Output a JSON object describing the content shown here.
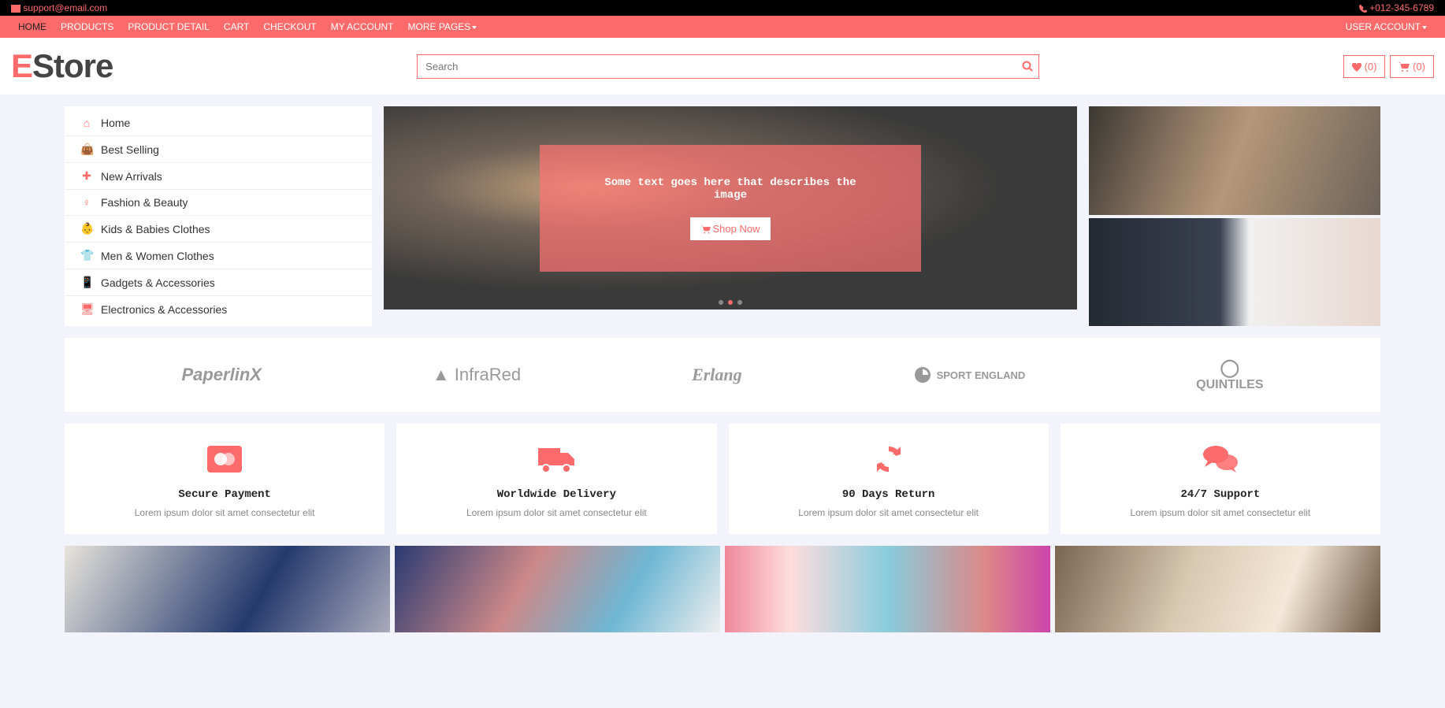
{
  "top": {
    "email": "support@email.com",
    "phone": "+012-345-6789"
  },
  "nav": {
    "items": [
      "HOME",
      "PRODUCTS",
      "PRODUCT DETAIL",
      "CART",
      "CHECKOUT",
      "MY ACCOUNT",
      "MORE PAGES"
    ],
    "user": "USER ACCOUNT"
  },
  "logo": {
    "e": "E",
    "rest": "Store"
  },
  "search": {
    "placeholder": "Search"
  },
  "headerBtns": {
    "wish": "(0)",
    "cart": "(0)"
  },
  "sidebar": [
    {
      "icon": "home",
      "label": "Home"
    },
    {
      "icon": "bag",
      "label": "Best Selling"
    },
    {
      "icon": "plus",
      "label": "New Arrivals"
    },
    {
      "icon": "female",
      "label": "Fashion & Beauty"
    },
    {
      "icon": "child",
      "label": "Kids & Babies Clothes"
    },
    {
      "icon": "shirt",
      "label": "Men & Women Clothes"
    },
    {
      "icon": "mobile",
      "label": "Gadgets & Accessories"
    },
    {
      "icon": "tv",
      "label": "Electronics & Accessories"
    }
  ],
  "hero": {
    "text": "Some text goes here that describes the image",
    "btn": "Shop Now"
  },
  "brands": [
    "PaperlinX",
    "InfraRed",
    "Erlang",
    "SPORT ENGLAND",
    "QUINTILES"
  ],
  "features": [
    {
      "title": "Secure Payment",
      "desc": "Lorem ipsum dolor sit amet consectetur elit"
    },
    {
      "title": "Worldwide Delivery",
      "desc": "Lorem ipsum dolor sit amet consectetur elit"
    },
    {
      "title": "90 Days Return",
      "desc": "Lorem ipsum dolor sit amet consectetur elit"
    },
    {
      "title": "24/7 Support",
      "desc": "Lorem ipsum dolor sit amet consectetur elit"
    }
  ]
}
